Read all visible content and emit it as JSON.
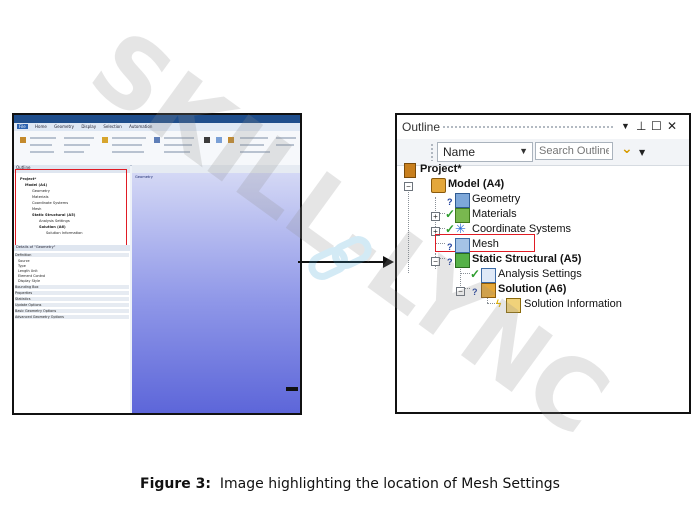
{
  "mini_screenshot": {
    "tabs": [
      "File",
      "Home",
      "Geometry",
      "Display",
      "Selection",
      "Automation"
    ],
    "window_title": "Static Structural - Mechanical [ANSYS]",
    "outline_label": "Outline",
    "search_placeholder": "Search Outline",
    "tree": [
      "Project*",
      "Model (A4)",
      "Geometry",
      "Materials",
      "Coordinate Systems",
      "Mesh",
      "Static Structural (A5)",
      "Analysis Settings",
      "Solution (A6)",
      "Solution Information"
    ],
    "details_title": "Details of \"Geometry\"",
    "details_rows": [
      "Definition",
      "Source",
      "Type",
      "Length Unit",
      "Element Control",
      "Display Style",
      "Bounding Box",
      "Properties",
      "Statistics",
      "Update Options",
      "Basic Geometry Options",
      "Advanced Geometry Options"
    ],
    "viewport_title": "Geometry"
  },
  "outline": {
    "title": "Outline",
    "window_controls": {
      "dropdown": "▼",
      "pin": "⊥",
      "maximize": "☐",
      "close": "✕"
    },
    "filter_select": "Name",
    "search_placeholder": "Search Outline",
    "tree": {
      "project": "Project*",
      "model": "Model (A4)",
      "geometry": "Geometry",
      "materials": "Materials",
      "coordinate_systems": "Coordinate Systems",
      "mesh": "Mesh",
      "static_structural": "Static Structural (A5)",
      "analysis_settings": "Analysis Settings",
      "solution": "Solution (A6)",
      "solution_information": "Solution Information"
    },
    "highlighted_item": "Mesh",
    "highlight_color": "#e01b24"
  },
  "watermark": "SKILL-LYNC",
  "caption": {
    "lead": "Figure 3:",
    "text": "  Image highlighting the location of Mesh Settings"
  }
}
